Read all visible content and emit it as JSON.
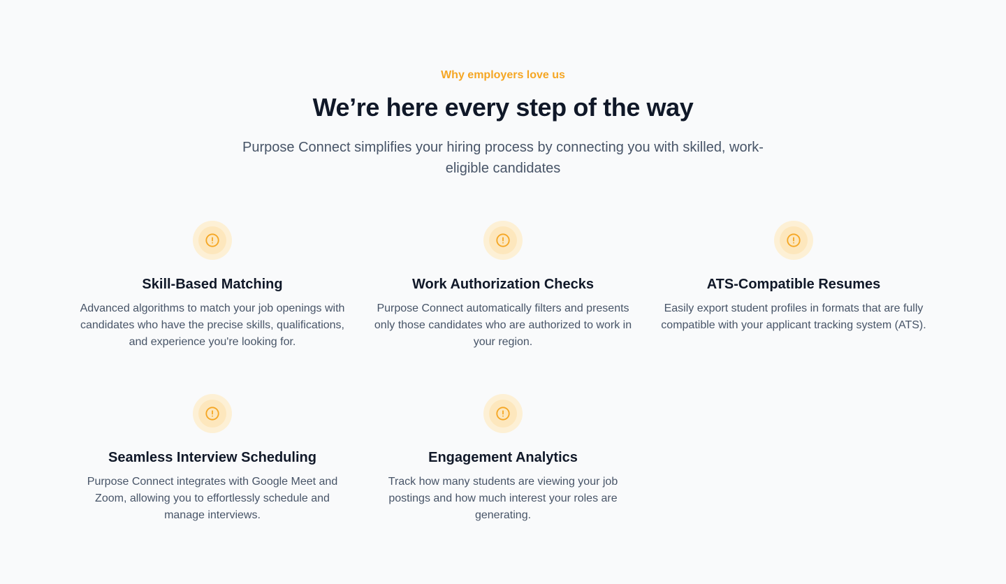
{
  "section": {
    "eyebrow": "Why employers love us",
    "headline": "We’re here every step of the way",
    "supporting": "Purpose Connect simplifies your hiring process by connecting you with skilled, work-eligible candidates"
  },
  "features": [
    {
      "icon": "alert-circle-icon",
      "title": "Skill-Based Matching",
      "description": "Advanced algorithms to match your job openings with candidates who have the precise skills, qualifications, and experience you're looking for."
    },
    {
      "icon": "alert-circle-icon",
      "title": "Work Authorization Checks",
      "description": "Purpose Connect automatically filters and presents only those candidates who are authorized to work in your region."
    },
    {
      "icon": "alert-circle-icon",
      "title": "ATS-Compatible Resumes",
      "description": "Easily export student profiles in formats that are fully compatible with your applicant tracking system (ATS)."
    },
    {
      "icon": "alert-circle-icon",
      "title": "Seamless Interview Scheduling",
      "description": "Purpose Connect integrates with Google Meet and Zoom, allowing you to effortlessly schedule and manage interviews."
    },
    {
      "icon": "alert-circle-icon",
      "title": "Engagement Analytics",
      "description": "Track how many students are viewing your job postings and how much interest your roles are generating."
    }
  ],
  "colors": {
    "accent": "#f5a623",
    "icon_ring_outer": "#fdf0d5",
    "icon_ring_inner": "#fde7bd",
    "heading": "#101828",
    "body_text": "#475467",
    "background": "#f9fafb"
  }
}
